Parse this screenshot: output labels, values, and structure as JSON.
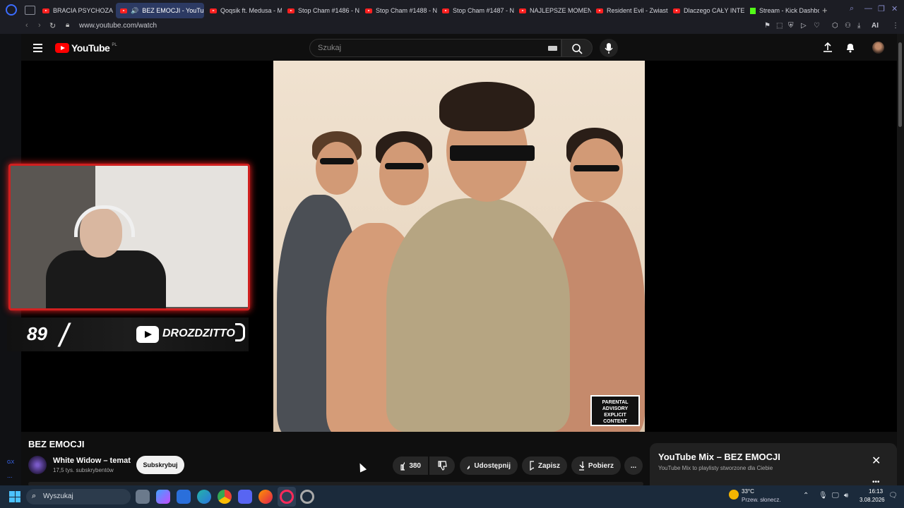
{
  "browser": {
    "tabs": [
      {
        "label": "BRACIA PSYCHOZA -",
        "icon": "youtube-icon"
      },
      {
        "label": "BEZ EMOCJI - YouTube",
        "icon": "youtube-icon",
        "active": true
      },
      {
        "label": "Qoqsik ft. Medusa - M",
        "icon": "youtube-icon"
      },
      {
        "label": "Stop Cham #1486 - N",
        "icon": "youtube-icon"
      },
      {
        "label": "Stop Cham #1488 - N",
        "icon": "youtube-icon"
      },
      {
        "label": "Stop Cham #1487 - N",
        "icon": "youtube-icon"
      },
      {
        "label": "NAJLEPSZE MOMENT",
        "icon": "youtube-icon"
      },
      {
        "label": "Resident Evil - Zwiast",
        "icon": "youtube-icon"
      },
      {
        "label": "Dlaczego CAŁY INTER",
        "icon": "youtube-icon"
      },
      {
        "label": "Stream - Kick Dashboa",
        "icon": "kick-icon"
      }
    ],
    "new_tab": "+",
    "url": "www.youtube.com/watch",
    "ai_label": "AI"
  },
  "youtube": {
    "logo_text": "YouTube",
    "region": "PL",
    "search_placeholder": "Szukaj"
  },
  "overlay": {
    "counter": "89",
    "slash": "/",
    "channel": "DROZDZITTO"
  },
  "thumbnail": {
    "badge_line1": "PARENTAL",
    "badge_line2": "ADVISORY",
    "badge_line3": "EXPLICIT CONTENT"
  },
  "video": {
    "title": "BEZ EMOCJI",
    "channel_name": "White Widow – temat",
    "subscribers": "17,5 tys. subskrybentów",
    "subscribe_label": "Subskrybuj",
    "likes": "380",
    "share_label": "Udostępnij",
    "save_label": "Zapisz",
    "download_label": "Pobierz",
    "more_label": "..."
  },
  "mix": {
    "title": "YouTube Mix – BEZ EMOCJI",
    "subtitle": "YouTube Mix to playlisty stworzone dla Ciebie"
  },
  "taskbar": {
    "search_placeholder": "Wyszukaj",
    "temperature": "33°C",
    "weather": "Przew. słonecz.",
    "time": "16:13",
    "date": "3.08.2026"
  },
  "sidebar": {
    "gx_label": "GX",
    "more": "..."
  },
  "colors": {
    "youtube_red": "#ff0000",
    "accent": "#d02020",
    "tab_active": "#2c3a63"
  }
}
